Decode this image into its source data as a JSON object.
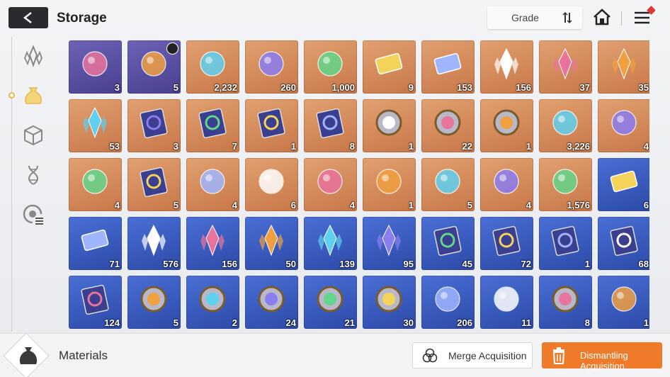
{
  "header": {
    "title": "Storage",
    "grade_label": "Grade"
  },
  "sidebar": {
    "items": [
      "crystal-icon",
      "pouch-icon",
      "cube-icon",
      "dna-icon",
      "radar-icon"
    ],
    "active_index": 1
  },
  "grid": {
    "rows": [
      [
        {
          "bg": "purple",
          "item": "rock-skull",
          "count": "3"
        },
        {
          "bg": "purple",
          "item": "pyramid-relic",
          "count": "5",
          "clock": true
        },
        {
          "bg": "orange",
          "item": "blue-eye-orb",
          "count": "2,232"
        },
        {
          "bg": "orange",
          "item": "cyan-core",
          "count": "260"
        },
        {
          "bg": "orange",
          "item": "data-chip",
          "count": "1,000"
        },
        {
          "bg": "orange",
          "item": "gold-ticket",
          "count": "9"
        },
        {
          "bg": "orange",
          "item": "gold-ticket-2",
          "count": "153"
        },
        {
          "bg": "orange",
          "item": "pink-crystal",
          "count": "156"
        },
        {
          "bg": "orange",
          "item": "orange-crystal",
          "count": "37"
        },
        {
          "bg": "orange",
          "item": "green-crystal",
          "count": "35"
        }
      ],
      [
        {
          "bg": "orange",
          "item": "blue-crystal",
          "count": "53"
        },
        {
          "bg": "orange",
          "item": "sword-book",
          "count": "3"
        },
        {
          "bg": "orange",
          "item": "shield-book",
          "count": "7"
        },
        {
          "bg": "orange",
          "item": "bolt-book",
          "count": "1"
        },
        {
          "bg": "orange",
          "item": "gear-book",
          "count": "8"
        },
        {
          "bg": "orange",
          "item": "shield-medal",
          "count": "1"
        },
        {
          "bg": "orange",
          "item": "crest-medal",
          "count": "22"
        },
        {
          "bg": "orange",
          "item": "target-medal",
          "count": "1"
        },
        {
          "bg": "orange",
          "item": "gold-sprout",
          "count": "3,226"
        },
        {
          "bg": "orange",
          "item": "dark-cube",
          "count": "4"
        }
      ],
      [
        {
          "bg": "orange",
          "item": "sneakers",
          "count": "4"
        },
        {
          "bg": "orange",
          "item": "star-chart-book",
          "count": "5"
        },
        {
          "bg": "orange",
          "item": "spray-gun",
          "count": "4"
        },
        {
          "bg": "orange",
          "item": "paper-stack",
          "count": "6"
        },
        {
          "bg": "orange",
          "item": "envelope",
          "count": "4"
        },
        {
          "bg": "orange",
          "item": "dreamcatcher",
          "count": "1"
        },
        {
          "bg": "orange",
          "item": "diary",
          "count": "5"
        },
        {
          "bg": "orange",
          "item": "guitar-pick",
          "count": "4"
        },
        {
          "bg": "orange",
          "item": "music-scroll",
          "count": "1,576"
        },
        {
          "bg": "blue",
          "item": "blue-ticket",
          "count": "6"
        }
      ],
      [
        {
          "bg": "blue",
          "item": "blue-ticket-2",
          "count": "71"
        },
        {
          "bg": "blue",
          "item": "red-shard",
          "count": "576"
        },
        {
          "bg": "blue",
          "item": "orange-shard",
          "count": "156"
        },
        {
          "bg": "blue",
          "item": "purple-shard",
          "count": "50"
        },
        {
          "bg": "blue",
          "item": "green-shard",
          "count": "139"
        },
        {
          "bg": "blue",
          "item": "cyan-shard",
          "count": "95"
        },
        {
          "bg": "blue",
          "item": "sword-book-blue",
          "count": "45"
        },
        {
          "bg": "blue",
          "item": "shield-book-blue",
          "count": "72"
        },
        {
          "bg": "blue",
          "item": "eye-book-blue",
          "count": "1"
        },
        {
          "bg": "blue",
          "item": "cross-book-blue",
          "count": "68"
        }
      ],
      [
        {
          "bg": "blue",
          "item": "gear-book-blue",
          "count": "124"
        },
        {
          "bg": "blue",
          "item": "silver-medal-1",
          "count": "5"
        },
        {
          "bg": "blue",
          "item": "silver-medal-2",
          "count": "2"
        },
        {
          "bg": "blue",
          "item": "silver-medal-3",
          "count": "24"
        },
        {
          "bg": "blue",
          "item": "silver-medal-4",
          "count": "21"
        },
        {
          "bg": "blue",
          "item": "silver-medal-5",
          "count": "30"
        },
        {
          "bg": "blue",
          "item": "blue-flame",
          "count": "206"
        },
        {
          "bg": "blue",
          "item": "pocket-watch",
          "count": "11"
        },
        {
          "bg": "blue",
          "item": "star-badge",
          "count": "8"
        },
        {
          "bg": "blue",
          "item": "parchment",
          "count": "1"
        }
      ]
    ]
  },
  "footer": {
    "category_label": "Materials",
    "merge_label": "Merge Acquisition",
    "dismantle_label": "Dismantling Acquisition"
  },
  "colors": {
    "dismantle": "#ef7a2a",
    "purple_tile": "#5a50a8",
    "orange_tile": "#d38a58",
    "blue_tile": "#3a5cc0"
  }
}
